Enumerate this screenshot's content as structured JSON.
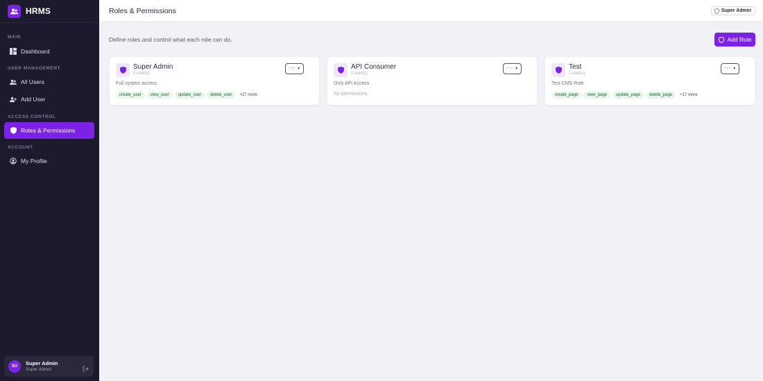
{
  "app": {
    "name": "HRMS",
    "logo_icon": "users-icon",
    "accent": "#7c22e8",
    "sidebar_bg": "#1d1a2e"
  },
  "sidebar": {
    "sections": [
      {
        "label": "MAIN"
      },
      {
        "label": "USER MANAGEMENT"
      },
      {
        "label": "ACCESS CONTROL"
      },
      {
        "label": "ACCOUNT"
      }
    ],
    "items": [
      {
        "label": "Dashboard",
        "icon": "dashboard-icon"
      },
      {
        "label": "All Users",
        "icon": "users-icon"
      },
      {
        "label": "Add User",
        "icon": "user-plus-icon"
      },
      {
        "label": "Roles & Permissions",
        "icon": "shield-icon",
        "active": true
      },
      {
        "label": "My Profile",
        "icon": "user-circle-icon"
      }
    ],
    "user": {
      "initials": "SU",
      "name": "Super Admin",
      "role": "Super Admin"
    }
  },
  "header": {
    "title": "Roles & Permissions",
    "badge": "Super Admin"
  },
  "main": {
    "description": "Define roles and control what each role can do.",
    "add_role_label": "Add Role",
    "roles": [
      {
        "name": "Super Admin",
        "users": "1 user(s)",
        "description": "Full system access",
        "menu_label": "···",
        "permissions": [
          "create_user",
          "view_user",
          "update_user",
          "delete_user"
        ],
        "more": "+27 more",
        "empty": ""
      },
      {
        "name": "API Consumer",
        "users": "1 user(s)",
        "description": "Only API Access",
        "menu_label": "···",
        "permissions": [],
        "more": "",
        "empty": "No permissions"
      },
      {
        "name": "Test",
        "users": "1 user(s)",
        "description": "Test CMS Role",
        "menu_label": "···",
        "permissions": [
          "create_page",
          "view_page",
          "update_page",
          "delete_page"
        ],
        "more": "+17 more",
        "empty": ""
      }
    ]
  }
}
